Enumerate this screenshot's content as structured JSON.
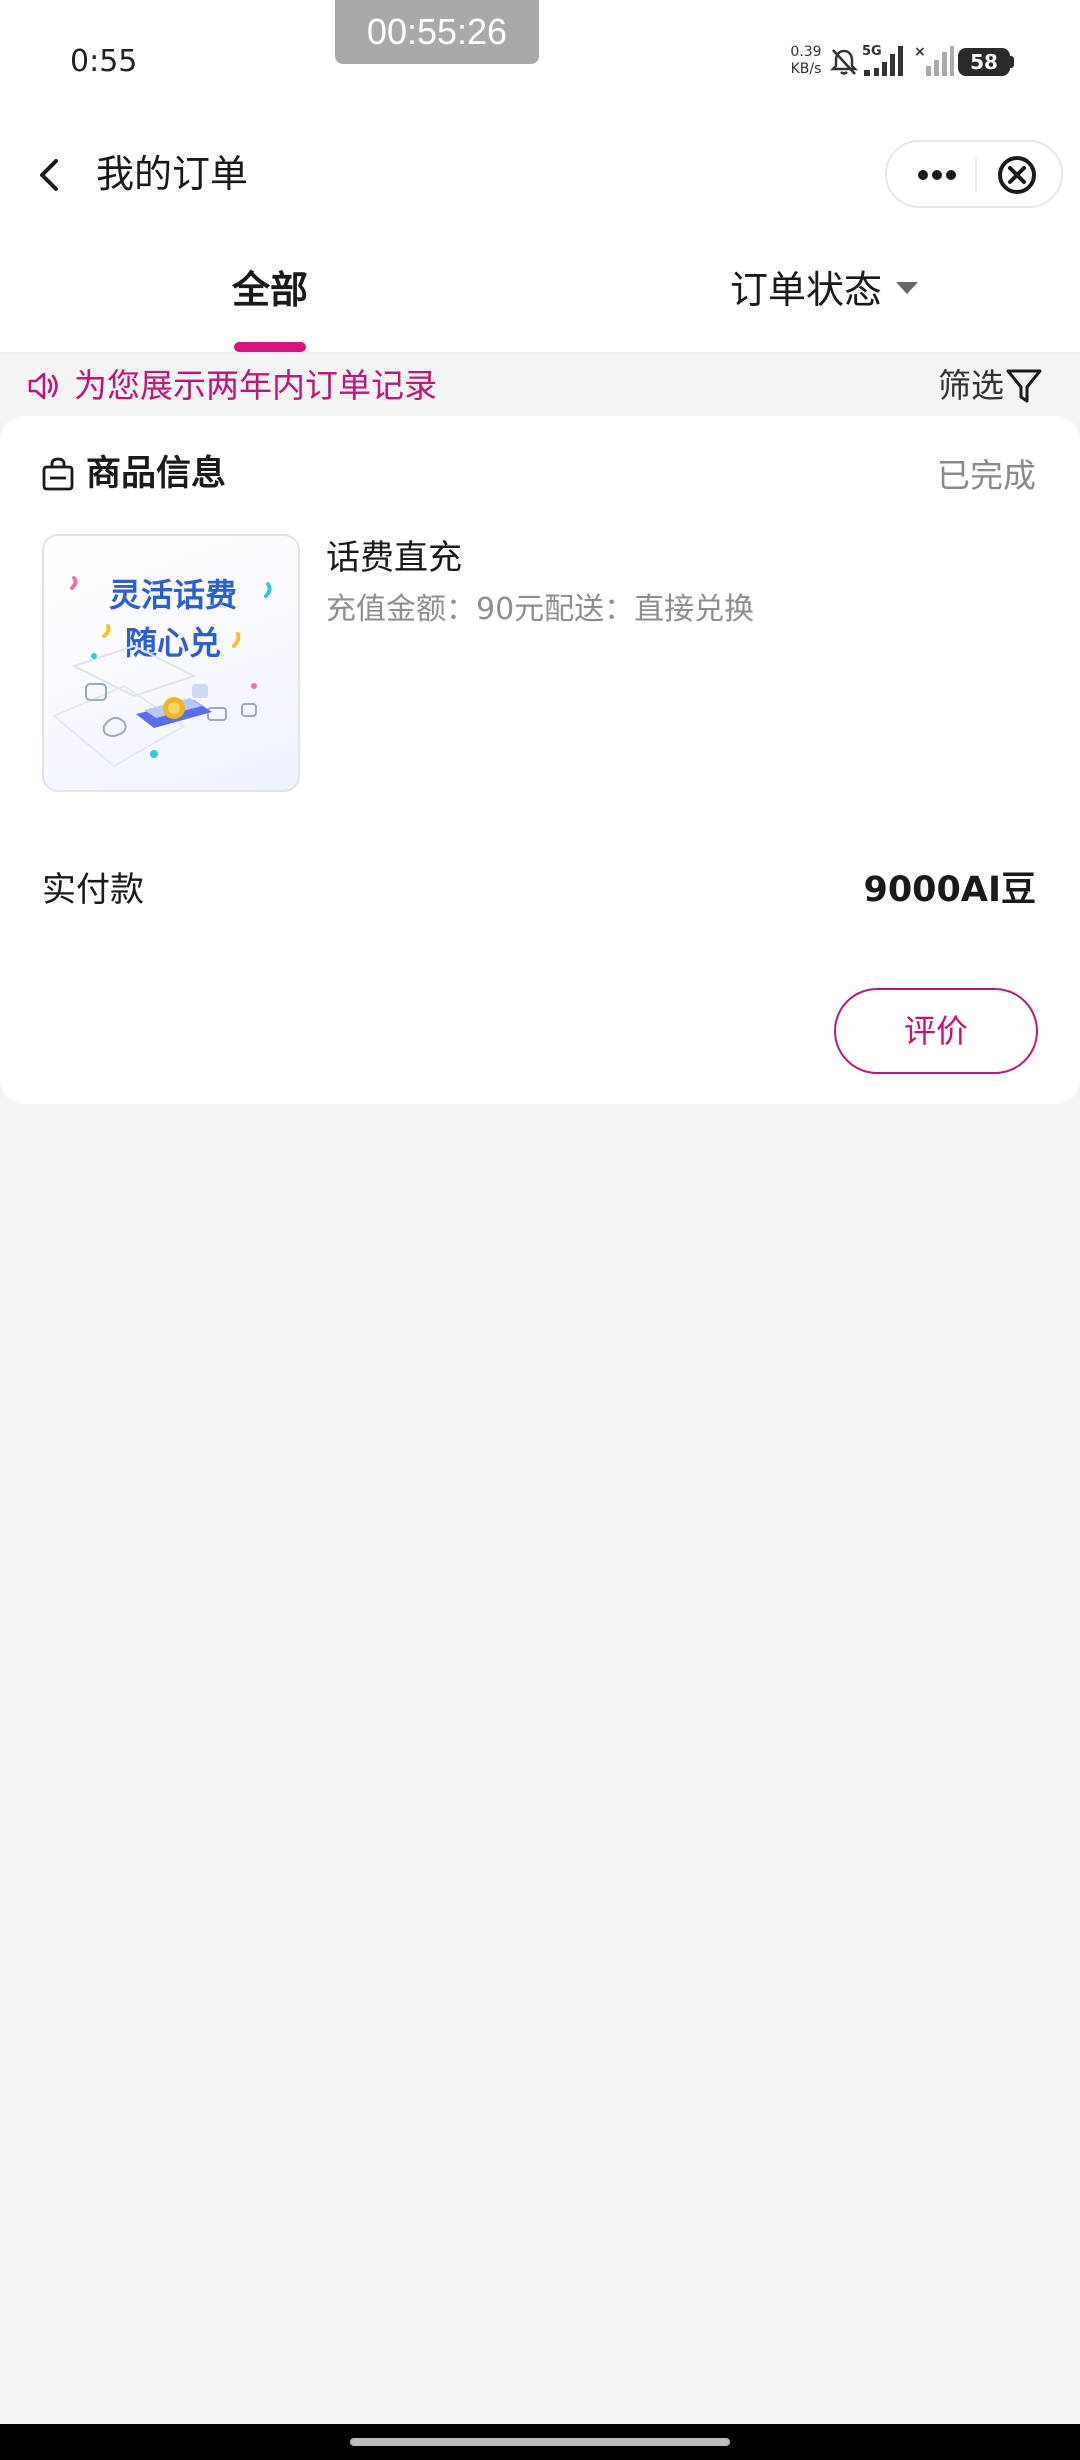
{
  "status_bar": {
    "time": "0:55",
    "recording_timer": "00:55:26",
    "net_speed_value": "0.39",
    "net_speed_unit": "KB/s",
    "network_type": "5G",
    "battery": "58"
  },
  "nav": {
    "title": "我的订单",
    "back_icon": "chevron-left-icon",
    "more_icon": "ellipsis-icon",
    "close_icon": "circle-close-icon"
  },
  "tabs": [
    {
      "label": "全部",
      "active": true
    },
    {
      "label": "订单状态",
      "active": false,
      "has_dropdown": true
    }
  ],
  "notice": {
    "text": "为您展示两年内订单记录",
    "filter_label": "筛选",
    "color": "#c2147a"
  },
  "order": {
    "section_title": "商品信息",
    "status": "已完成",
    "product": {
      "image_text_line1": "灵活话费",
      "image_text_line2": "随心兑",
      "name": "话费直充",
      "detail": "充值金额：90元配送：直接兑换"
    },
    "paid_label": "实付款",
    "paid_amount": "9000AI豆",
    "review_button": "评价"
  },
  "colors": {
    "accent": "#d6137e",
    "text_secondary": "#8e8e8e",
    "background": "#f4f4f4"
  }
}
